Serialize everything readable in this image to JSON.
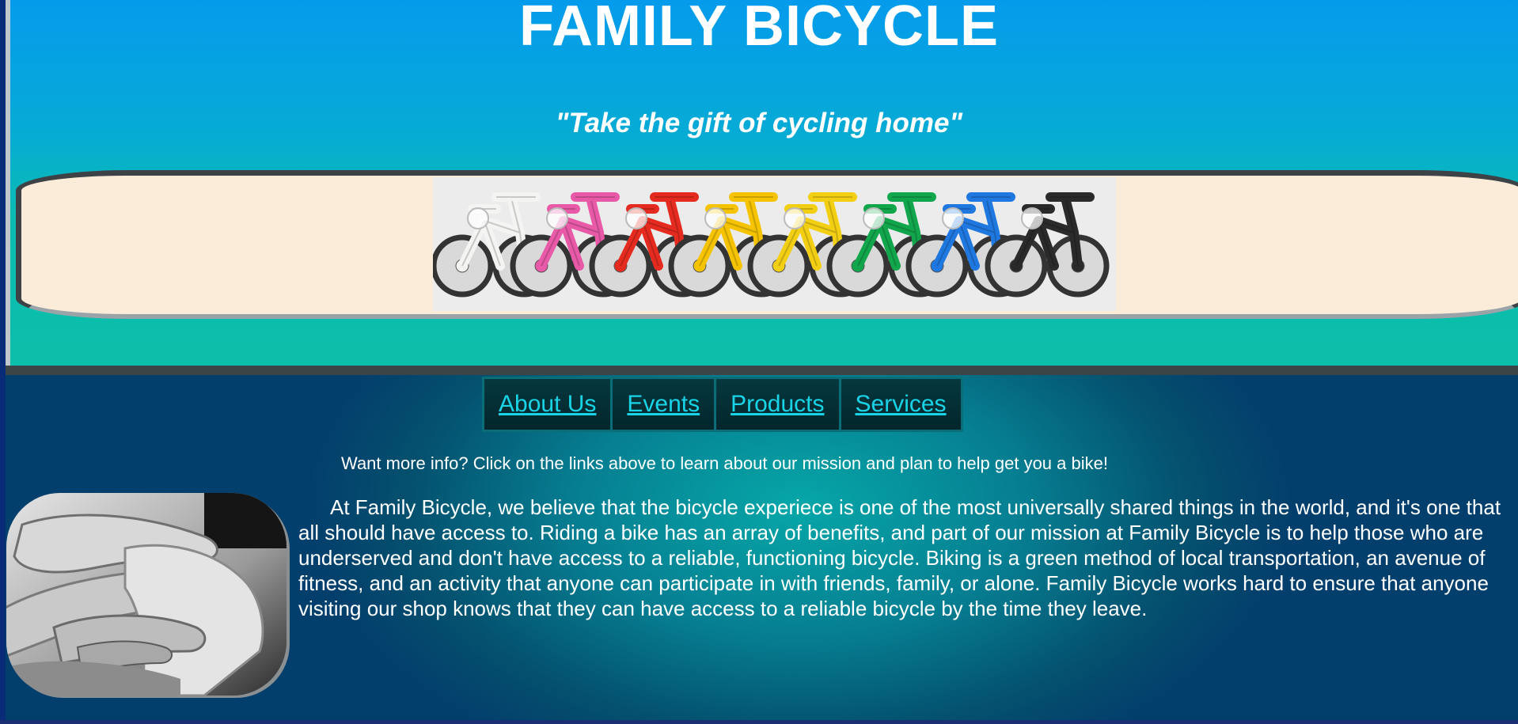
{
  "header": {
    "title": "FAMILY BICYCLE",
    "tagline": "\"Take the gift of cycling home\""
  },
  "banner": {
    "image": "rainbow-bicycles-image",
    "bike_colors": [
      "#f4f4f2",
      "#e85aa8",
      "#e52b1f",
      "#f5c300",
      "#f3cf14",
      "#12a64c",
      "#1f78e0",
      "#2a2a2a"
    ]
  },
  "nav": {
    "items": [
      {
        "label": "About Us"
      },
      {
        "label": "Events"
      },
      {
        "label": "Products"
      },
      {
        "label": "Services"
      }
    ]
  },
  "info": {
    "text": "Want more info? Click on the links above to learn about our mission and plan to help get you a bike!"
  },
  "about": {
    "image": "stacked-hands-photo",
    "text": "At Family Bicycle, we believe that the bicycle experiece is one of the most universally shared things in the world, and it's one that all should have access to. Riding a bike has an array of benefits, and part of our mission at Family Bicycle is to help those who are underserved and don't have access to a reliable, functioning bicycle. Biking is a green method of local transportation, an avenue of fitness, and an activity that anyone can participate in with friends, family, or alone. Family Bicycle works hard to ensure that anyone visiting our shop knows that they can have access to a reliable bicycle by the time they leave."
  },
  "colors": {
    "header_top": "#059bec",
    "header_bottom": "#0bbfaa",
    "banner_bg": "#fbebd9",
    "nav_link": "#18d4e6",
    "text": "#ffffff"
  }
}
